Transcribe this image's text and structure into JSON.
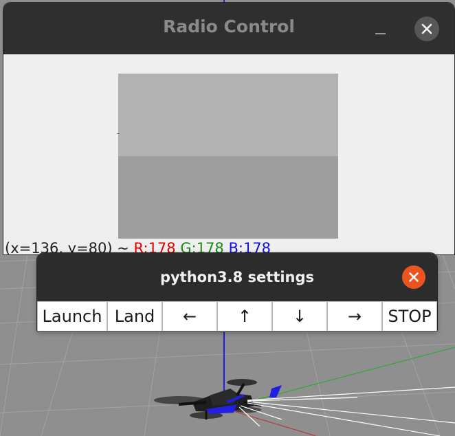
{
  "radio_window": {
    "title": "Radio Control",
    "status": {
      "coords": "(x=136, y=80) ~",
      "r": "R:178",
      "g": "G:178",
      "b": "B:178"
    },
    "camera": {
      "sky_color": "#b2b2b2",
      "ground_color": "#9e9e9e"
    }
  },
  "settings_window": {
    "title": "python3.8 settings",
    "buttons": {
      "launch": "Launch",
      "land": "Land",
      "left": "←",
      "up": "↑",
      "down": "↓",
      "right": "→",
      "stop": "STOP"
    },
    "close_color": "#e9541f"
  },
  "colors": {
    "titlebar": "#2f2f2f",
    "window_bg": "#efefef",
    "ground": "#8e8e8e"
  }
}
